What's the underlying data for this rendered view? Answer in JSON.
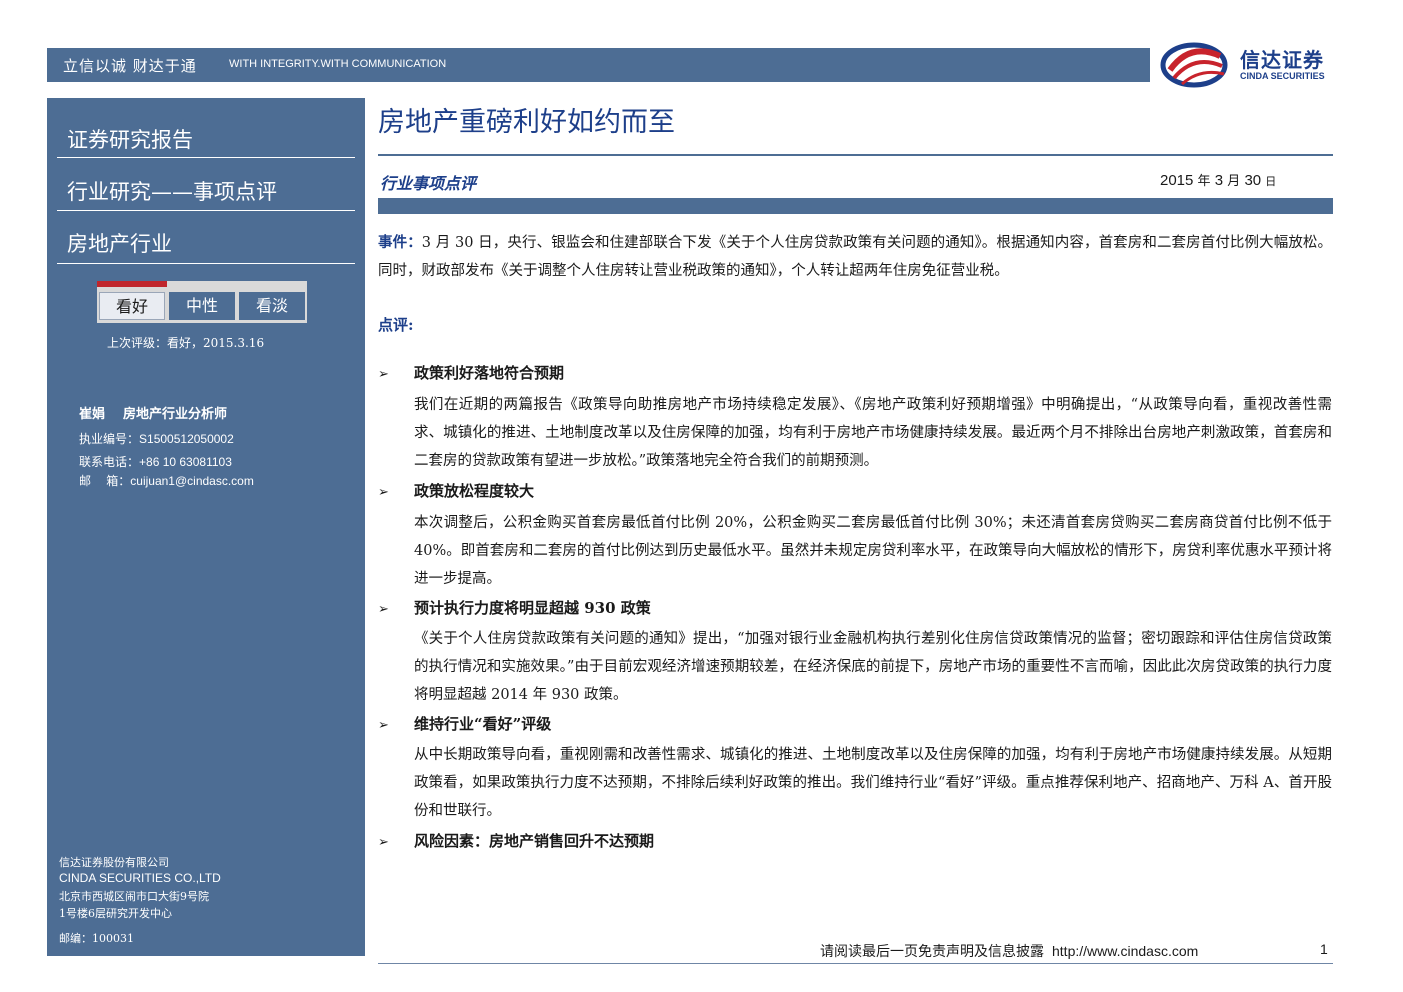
{
  "banner": {
    "slogan_cn": "立信以诚  财达于通",
    "slogan_en": "WITH INTEGRITY.WITH COMMUNICATION"
  },
  "logo": {
    "name_cn": "信达证券",
    "name_en": "CINDA SECURITIES",
    "colors": {
      "red": "#c8232c",
      "blue": "#1d3f8a"
    }
  },
  "sidebar": {
    "titles": [
      "证券研究报告",
      "行业研究——事项点评",
      "房地产行业"
    ],
    "ratings": [
      "看好",
      "中性",
      "看淡"
    ],
    "selected_rating": "看好",
    "previous_rating": "上次评级：看好，2015.3.16",
    "analyst": {
      "name": "崔娟",
      "title": "房地产行业分析师"
    },
    "contacts": [
      {
        "label": "执业编号：",
        "value": "S1500512050002"
      },
      {
        "label": "联系电话：",
        "value": "+86 10 63081103"
      },
      {
        "label": "邮    箱：",
        "value": "cuijuan1@cindasc.com"
      }
    ],
    "company": {
      "name_cn": "信达证券股份有限公司",
      "name_en": "CINDA SECURITIES CO.,LTD",
      "address_1": "北京市西城区闹市口大街9号院",
      "address_2": "1号楼6层研究开发中心",
      "postcode": "邮编：100031"
    }
  },
  "report": {
    "title": "房地产重磅利好如约而至",
    "type": "行业事项点评",
    "date": {
      "year": "2015",
      "year_unit": "年",
      "month": "3",
      "month_unit": "月",
      "day": "30",
      "day_unit": "日"
    },
    "event_label": "事件：",
    "event_text": "3 月 30 日，央行、银监会和住建部联合下发《关于个人住房贷款政策有关问题的通知》。根据通知内容，首套房和二套房首付比例大幅放松。同时，财政部发布《关于调整个人住房转让营业税政策的通知》，个人转让超两年住房免征营业税。",
    "comment_label": "点评:",
    "points": [
      {
        "heading": "政策利好落地符合预期",
        "body": "我们在近期的两篇报告《政策导向助推房地产市场持续稳定发展》、《房地产政策利好预期增强》中明确提出，“从政策导向看，重视改善性需求、城镇化的推进、土地制度改革以及住房保障的加强，均有利于房地产市场健康持续发展。最近两个月不排除出台房地产刺激政策，首套房和二套房的贷款政策有望进一步放松。”政策落地完全符合我们的前期预测。"
      },
      {
        "heading": "政策放松程度较大",
        "body": "本次调整后，公积金购买首套房最低首付比例 20%，公积金购买二套房最低首付比例 30%；未还清首套房贷购买二套房商贷首付比例不低于 40%。即首套房和二套房的首付比例达到历史最低水平。虽然并未规定房贷利率水平，在政策导向大幅放松的情形下，房贷利率优惠水平预计将进一步提高。"
      },
      {
        "heading": "预计执行力度将明显超越 930 政策",
        "body": "《关于个人住房贷款政策有关问题的通知》提出，“加强对银行业金融机构执行差别化住房信贷政策情况的监督；密切跟踪和评估住房信贷政策的执行情况和实施效果。”由于目前宏观经济增速预期较差，在经济保底的前提下，房地产市场的重要性不言而喻，因此此次房贷政策的执行力度将明显超越 2014 年 930 政策。"
      },
      {
        "heading": "维持行业“看好”评级",
        "body": "从中长期政策导向看，重视刚需和改善性需求、城镇化的推进、土地制度改革以及住房保障的加强，均有利于房地产市场健康持续发展。从短期政策看，如果政策执行力度不达预期，不排除后续利好政策的推出。我们维持行业“看好”评级。重点推荐保利地产、招商地产、万科 A、首开股份和世联行。"
      },
      {
        "heading": "风险因素：房地产销售回升不达预期",
        "body": ""
      }
    ],
    "bullet_glyph": "➢"
  },
  "footer": {
    "disclaimer": "请阅读最后一页免责声明及信息披露",
    "url": "http://www.cindasc.com",
    "page": "1"
  }
}
